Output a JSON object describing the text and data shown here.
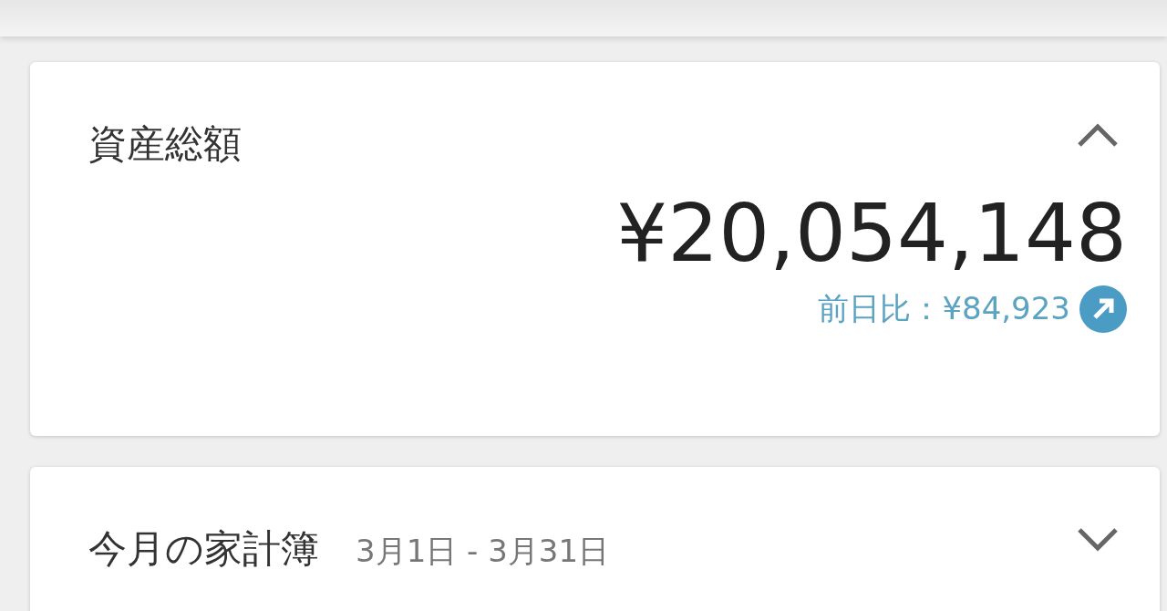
{
  "summary_card": {
    "title": "資産総額",
    "expanded": true,
    "total": "¥20,054,148",
    "change": {
      "label": "前日比：¥84,923",
      "rising": true
    }
  },
  "budget_card": {
    "title": "今月の家計簿",
    "period": "3月1日 - 3月31日",
    "expanded": false
  }
}
